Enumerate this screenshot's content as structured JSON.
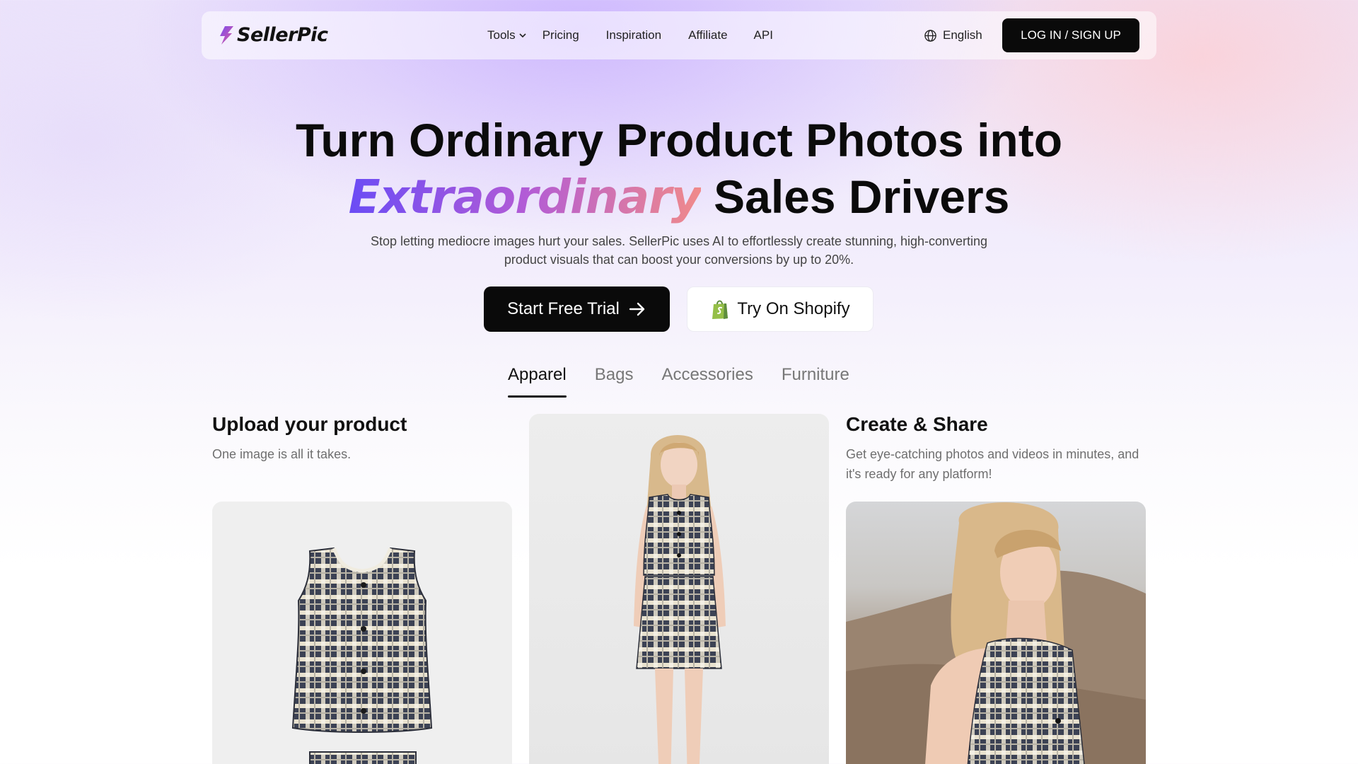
{
  "nav": {
    "logo_text": "SellerPic",
    "links": [
      {
        "label": "Tools",
        "has_dropdown": true
      },
      {
        "label": "Pricing"
      },
      {
        "label": "Inspiration"
      },
      {
        "label": "Affiliate"
      },
      {
        "label": "API"
      }
    ],
    "language": "English",
    "login_label": "LOG IN / SIGN UP"
  },
  "hero": {
    "title_line1": "Turn Ordinary Product Photos into",
    "title_highlight": "Extraordinary",
    "title_rest": " Sales Drivers",
    "subtitle_line1": "Stop letting mediocre images hurt your sales. SellerPic uses AI to effortlessly create stunning, high-converting",
    "subtitle_line2": "product visuals that can boost your conversions by up to 20%.",
    "cta_primary": "Start Free Trial",
    "cta_secondary": "Try On Shopify"
  },
  "tabs": [
    {
      "label": "Apparel",
      "active": true
    },
    {
      "label": "Bags",
      "active": false
    },
    {
      "label": "Accessories",
      "active": false
    },
    {
      "label": "Furniture",
      "active": false
    }
  ],
  "steps": {
    "upload": {
      "title": "Upload your product",
      "desc": "One image is all it takes."
    },
    "create": {
      "title": "Create & Share",
      "desc_line1": "Get eye-catching photos and videos in minutes, and",
      "desc_line2": "it's ready for any platform!"
    }
  },
  "colors": {
    "primary_button": "#0a0a0a",
    "gradient_start": "#6b4cf5",
    "gradient_end": "#f08a8a",
    "shopify_green": "#95bf47"
  }
}
